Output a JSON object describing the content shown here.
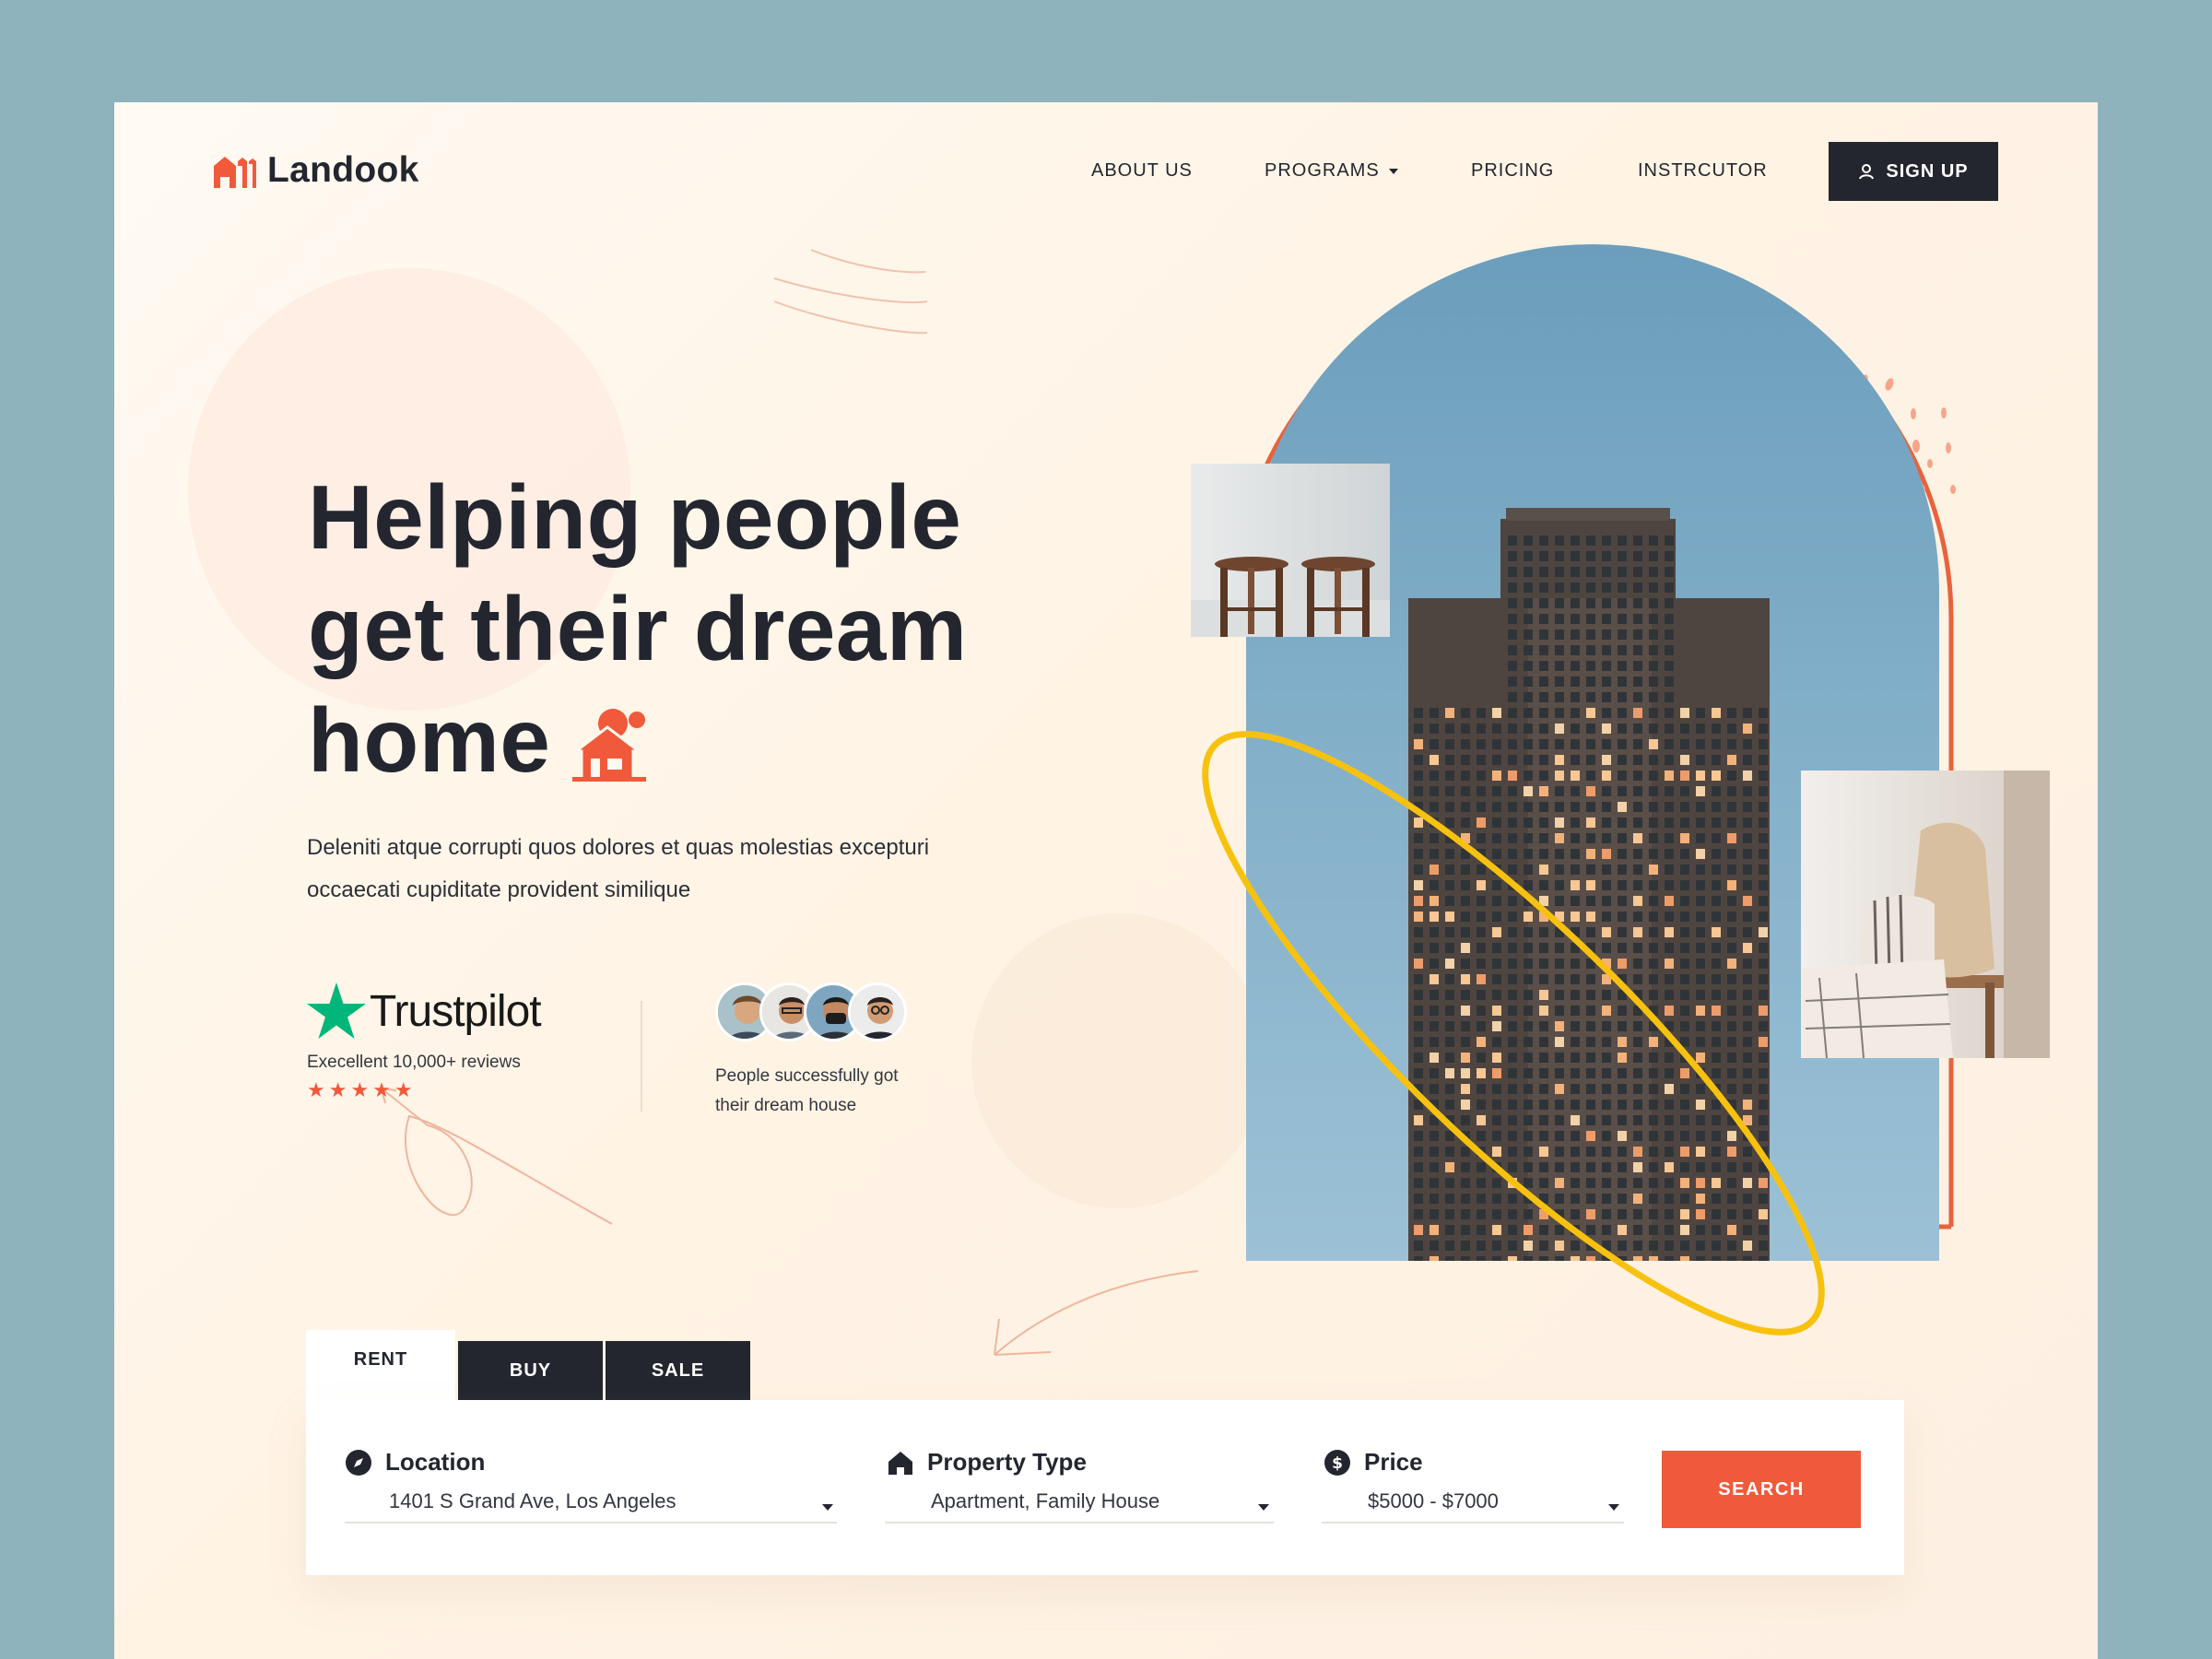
{
  "brand": {
    "name": "Landook",
    "accent": "#f05a3b",
    "dark": "#23262f"
  },
  "nav": {
    "items": [
      {
        "label": "ABOUT US"
      },
      {
        "label": "PROGRAMS",
        "has_dropdown": true
      },
      {
        "label": "PRICING"
      },
      {
        "label": "INSTRCUTOR"
      }
    ],
    "signup_label": "SIGN UP"
  },
  "hero": {
    "headline_line1": "Helping people",
    "headline_line2": "get their dream",
    "headline_line3": "home",
    "description_line1": "Deleniti atque corrupti quos dolores et quas molestias excepturi",
    "description_line2": "occaecati cupiditate provident similique"
  },
  "trustpilot": {
    "name": "Trustpilot",
    "reviews": "Execellent 10,000+ reviews",
    "rating": 5,
    "stars": "★★★★★"
  },
  "people": {
    "text_line1": "People successfully got",
    "text_line2": "their dream house",
    "avatar_count": 4
  },
  "tabs": [
    {
      "label": "RENT",
      "active": true
    },
    {
      "label": "BUY",
      "active": false
    },
    {
      "label": "SALE",
      "active": false
    }
  ],
  "search": {
    "location": {
      "label": "Location",
      "value": "1401 S Grand Ave, Los Angeles",
      "icon": "compass-icon"
    },
    "property_type": {
      "label": "Property Type",
      "value": "Apartment, Family House",
      "icon": "home-icon"
    },
    "price": {
      "label": "Price",
      "value": "$5000 - $7000",
      "icon": "dollar-icon"
    },
    "button_label": "SEARCH"
  }
}
